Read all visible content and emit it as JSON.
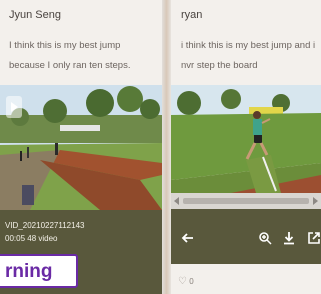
{
  "left_post": {
    "author": "Jyun Seng",
    "text_line1": "I think this is my best jump",
    "text_line2": "because I only ran ten steps.",
    "video_name": "VID_20210227112143",
    "video_meta": "00:05 48 video"
  },
  "right_post": {
    "author": "ryan",
    "text_line1": "i think this is my best jump and i",
    "text_line2": "nvr step the board",
    "likes": "0"
  },
  "badge": {
    "label": "rning"
  },
  "colors": {
    "accent": "#6a2aa5",
    "toolbar": "#59583c"
  }
}
